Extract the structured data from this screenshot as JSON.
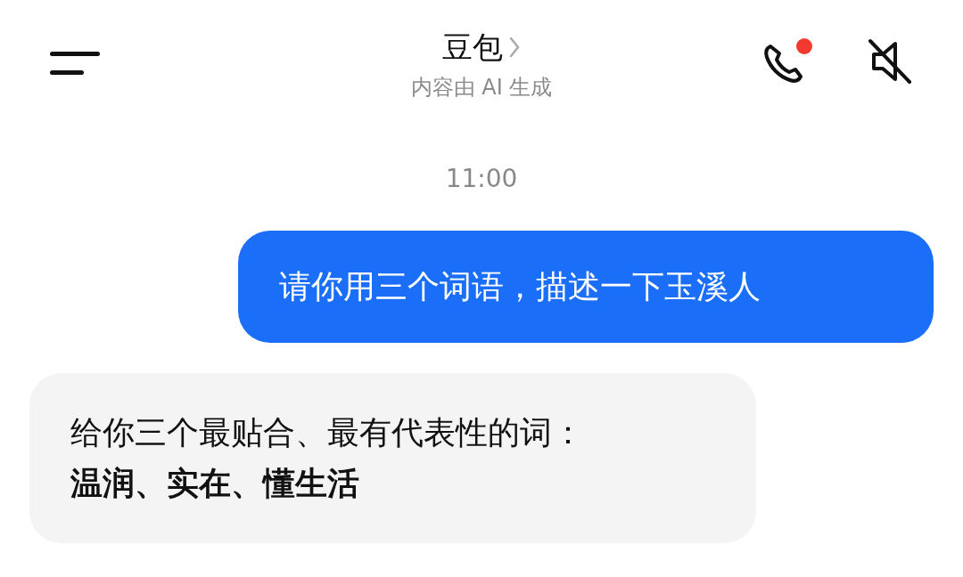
{
  "header": {
    "title": "豆包",
    "subtitle": "内容由 AI 生成",
    "call_notification": true,
    "muted": true
  },
  "messages": [
    {
      "kind": "timestamp",
      "text": "11:00"
    },
    {
      "kind": "user",
      "text": "请你用三个词语，描述一下玉溪人"
    },
    {
      "kind": "bot",
      "lines": [
        {
          "text": "给你三个最贴合、最有代表性的词：",
          "bold": false
        },
        {
          "text": "温润、实在、懂生活",
          "bold": true
        }
      ]
    }
  ]
}
